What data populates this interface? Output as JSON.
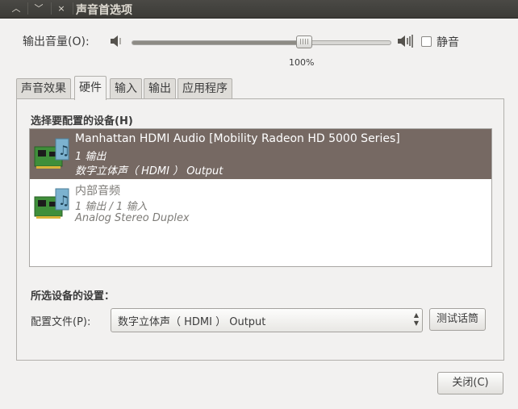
{
  "window": {
    "title": "声音首选项",
    "controls": {
      "up": "^",
      "down": "v",
      "close": "×"
    }
  },
  "volume": {
    "label": "输出音量(O):",
    "level_percent": 100,
    "percent_text": "100%",
    "mute_label": "静音",
    "mute_checked": false
  },
  "tabs": [
    {
      "label": "声音效果",
      "active": false
    },
    {
      "label": "硬件",
      "active": true
    },
    {
      "label": "输入",
      "active": false
    },
    {
      "label": "输出",
      "active": false
    },
    {
      "label": "应用程序",
      "active": false
    }
  ],
  "hardware": {
    "device_section_title": "选择要配置的设备(H)",
    "devices": [
      {
        "name": "Manhattan HDMI Audio [Mobility Radeon HD 5000 Series]",
        "ports": "1 输出",
        "profile": "数字立体声（ HDMI ） Output",
        "selected": true
      },
      {
        "name": "内部音频",
        "ports": "1 输出 / 1 输入",
        "profile": "Analog Stereo Duplex",
        "selected": false
      }
    ],
    "settings_section_title": "所选设备的设置：",
    "profile_label": "配置文件(P):",
    "profile_value": "数字立体声（ HDMI ） Output",
    "test_button": "测试话筒"
  },
  "footer": {
    "close_button": "关闭(C)"
  },
  "colors": {
    "selection": "#766963",
    "titlebar": "#3c3b37"
  }
}
